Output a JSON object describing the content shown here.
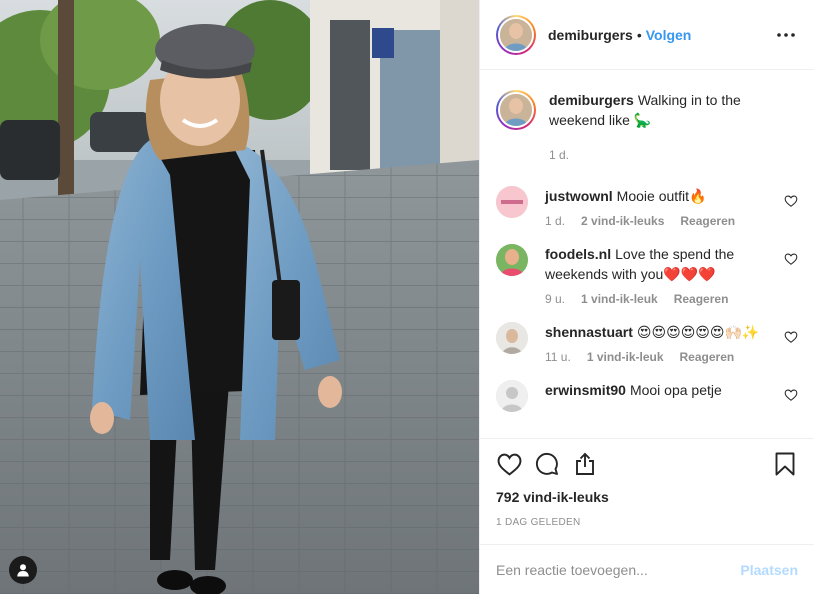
{
  "colors": {
    "accent": "#3897f0",
    "text": "#262626",
    "muted": "#8e8e8e",
    "post_disabled": "#b3dbff",
    "like_heart": "#ed4956"
  },
  "photo": {
    "icon": "user-tag-icon"
  },
  "header": {
    "username": "demiburgers",
    "separator": "•",
    "follow_label": "Volgen",
    "more_icon": "more-horizontal-icon"
  },
  "caption": {
    "username": "demiburgers",
    "text": "Walking in to the weekend like 🦕",
    "age": "1 d."
  },
  "comments": [
    {
      "username": "justwownl",
      "text": "Mooie outfit🔥",
      "age": "1 d.",
      "likes": "2 vind-ik-leuks",
      "reply": "Reageren"
    },
    {
      "username": "foodels.nl",
      "text": "Love the spend the weekends with you❤️❤️❤️",
      "age": "9 u.",
      "likes": "1 vind-ik-leuk",
      "reply": "Reageren"
    },
    {
      "username": "shennastuart",
      "text": "😍😍😍😍😍😍🙌🏻✨",
      "age": "11 u.",
      "likes": "1 vind-ik-leuk",
      "reply": "Reageren"
    },
    {
      "username": "erwinsmit90",
      "text": "Mooi opa petje",
      "age": "",
      "likes": "",
      "reply": ""
    }
  ],
  "actions": {
    "like_icon": "heart-icon",
    "comment_icon": "comment-icon",
    "share_icon": "share-icon",
    "save_icon": "bookmark-icon"
  },
  "likes_total": "792 vind-ik-leuks",
  "post_age": "1 DAG GELEDEN",
  "add_comment": {
    "placeholder": "Een reactie toevoegen...",
    "post_label": "Plaatsen"
  }
}
